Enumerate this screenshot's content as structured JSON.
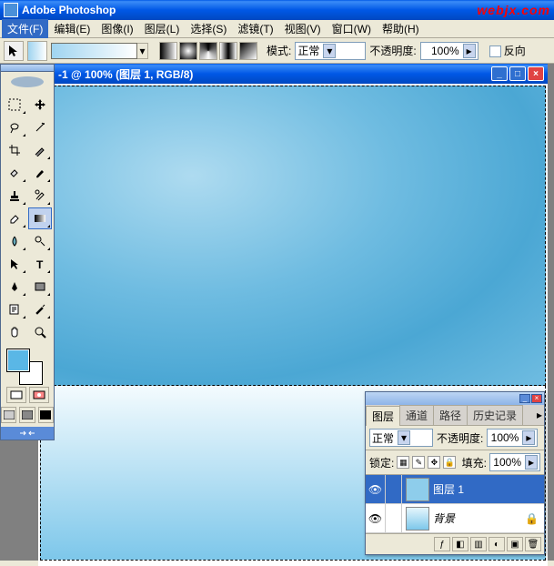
{
  "app": {
    "title": "Adobe Photoshop",
    "watermark": "webjx.com"
  },
  "menu": {
    "file": "文件(F)",
    "edit": "编辑(E)",
    "image": "图像(I)",
    "layer": "图层(L)",
    "select": "选择(S)",
    "filter": "滤镜(T)",
    "view": "视图(V)",
    "window": "窗口(W)",
    "help": "帮助(H)"
  },
  "options": {
    "mode_label": "模式:",
    "mode_value": "正常",
    "opacity_label": "不透明度:",
    "opacity_value": "100%",
    "reverse_label": "反向"
  },
  "document": {
    "title": "-1 @ 100% (图层 1, RGB/8)"
  },
  "layers_panel": {
    "tabs": {
      "layers": "图层",
      "channels": "通道",
      "paths": "路径",
      "history": "历史记录"
    },
    "blend_value": "正常",
    "opacity_label": "不透明度:",
    "opacity_value": "100%",
    "lock_label": "锁定:",
    "fill_label": "填充:",
    "fill_value": "100%",
    "layers": [
      {
        "name": "图层 1"
      },
      {
        "name": "背景"
      }
    ]
  }
}
